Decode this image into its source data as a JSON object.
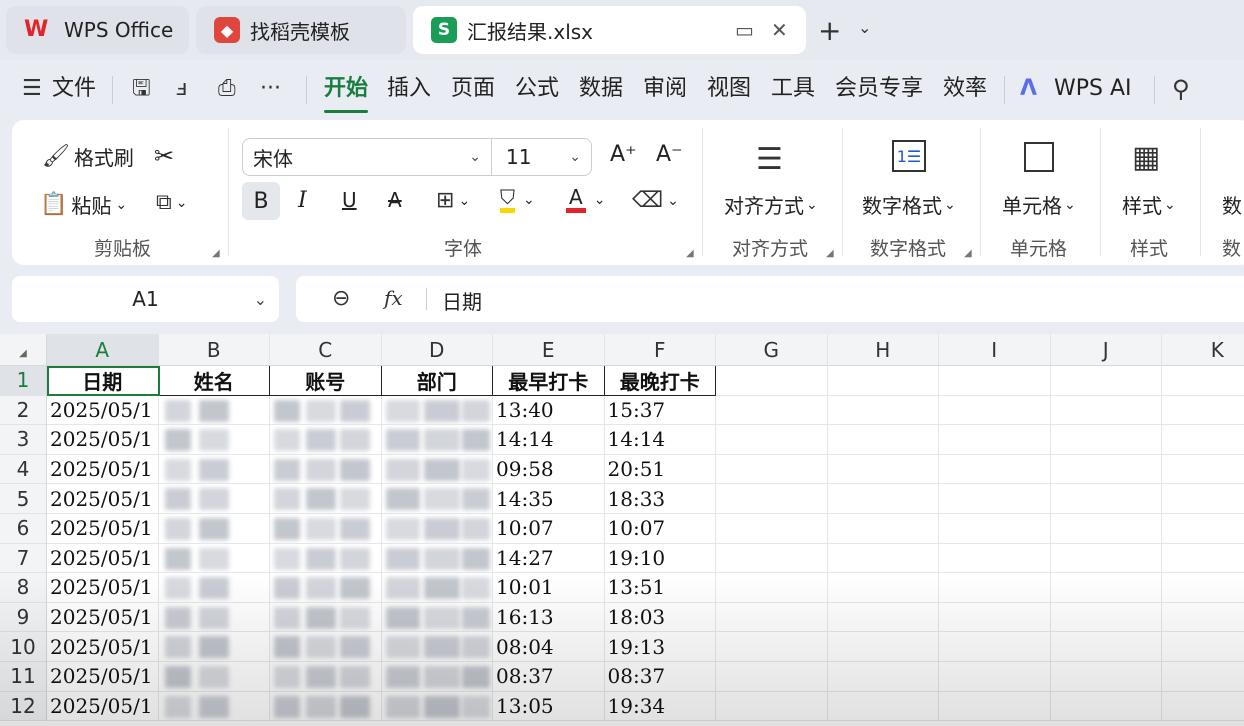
{
  "tabs": [
    {
      "label": "WPS Office",
      "icon": "wps-logo-icon"
    },
    {
      "label": "找稻壳模板",
      "icon": "template-icon"
    },
    {
      "label": "汇报结果.xlsx",
      "icon": "sheet-icon"
    }
  ],
  "menu": {
    "file": "文件",
    "items": [
      "开始",
      "插入",
      "页面",
      "公式",
      "数据",
      "审阅",
      "视图",
      "工具",
      "会员专享",
      "效率"
    ],
    "active": "开始",
    "ai": "WPS AI"
  },
  "ribbon": {
    "format_painter": "格式刷",
    "paste": "粘贴",
    "clipboard_group": "剪贴板",
    "font_name": "宋体",
    "font_size": "11",
    "bold": "B",
    "italic": "I",
    "underline": "U",
    "strike": "A",
    "font_group": "字体",
    "align": "对齐方式",
    "align_group": "对齐方式",
    "number_format": "数字格式",
    "number_group": "数字格式",
    "cells": "单元格",
    "cells_group": "单元格",
    "styles": "样式",
    "styles_group": "样式",
    "more": "数",
    "more_group": "数"
  },
  "formula_bar": {
    "name_box": "A1",
    "fx": "fx",
    "content": "日期"
  },
  "sheet": {
    "columns": [
      "A",
      "B",
      "C",
      "D",
      "E",
      "F",
      "G",
      "H",
      "I",
      "J",
      "K"
    ],
    "selected_column": "A",
    "header_row": [
      "日期",
      "姓名",
      "账号",
      "部门",
      "最早打卡",
      "最晚打卡"
    ],
    "rows": [
      {
        "num": "2",
        "date": "2025/05/1",
        "early": "13:40",
        "late": "15:37"
      },
      {
        "num": "3",
        "date": "2025/05/1",
        "early": "14:14",
        "late": "14:14"
      },
      {
        "num": "4",
        "date": "2025/05/1",
        "early": "09:58",
        "late": "20:51"
      },
      {
        "num": "5",
        "date": "2025/05/1",
        "early": "14:35",
        "late": "18:33"
      },
      {
        "num": "6",
        "date": "2025/05/1",
        "early": "10:07",
        "late": "10:07"
      },
      {
        "num": "7",
        "date": "2025/05/1",
        "early": "14:27",
        "late": "19:10"
      },
      {
        "num": "8",
        "date": "2025/05/1",
        "early": "10:01",
        "late": "13:51"
      },
      {
        "num": "9",
        "date": "2025/05/1",
        "early": "16:13",
        "late": "18:03"
      },
      {
        "num": "10",
        "date": "2025/05/1",
        "early": "08:04",
        "late": "19:13"
      },
      {
        "num": "11",
        "date": "2025/05/1",
        "early": "08:37",
        "late": "08:37"
      },
      {
        "num": "12",
        "date": "2025/05/1",
        "early": "13:05",
        "late": "19:34"
      }
    ]
  },
  "colors": {
    "accent": "#1a7d3f",
    "highlight_yellow": "#f5d800",
    "font_red": "#e0262b"
  }
}
